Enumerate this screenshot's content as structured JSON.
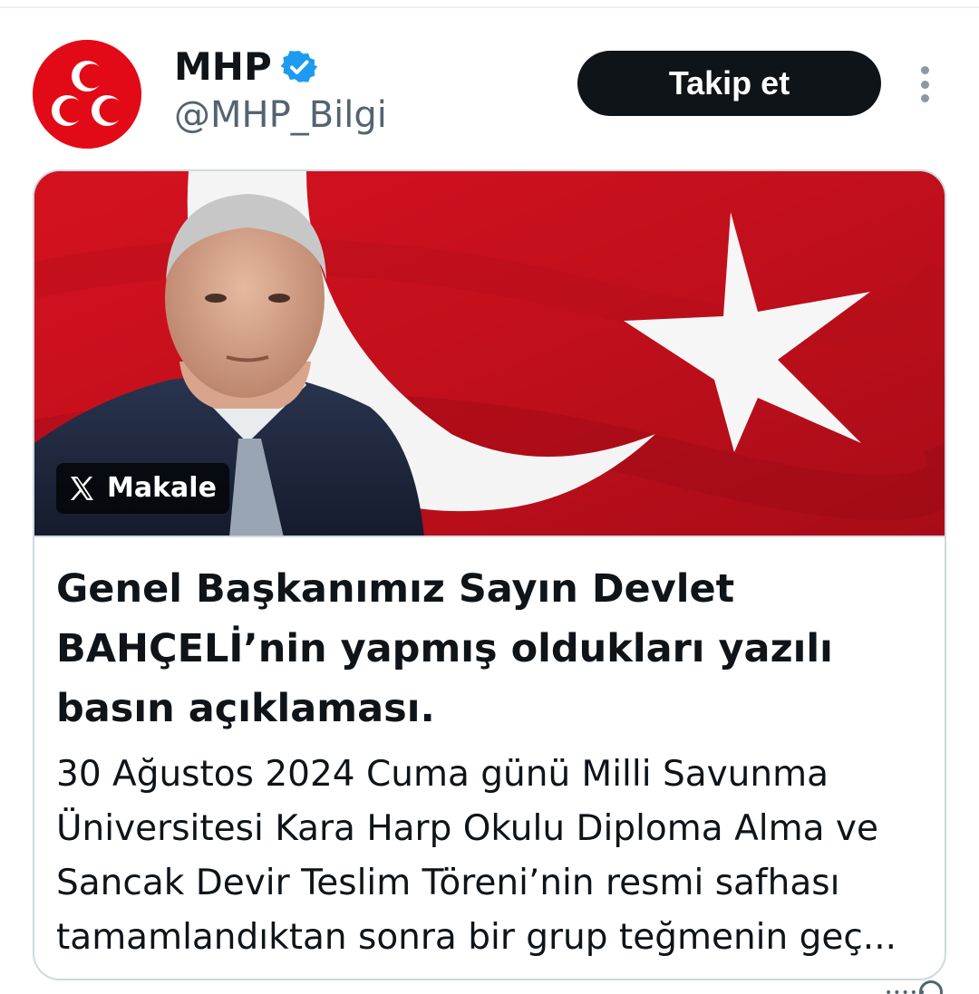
{
  "account": {
    "display_name": "MHP",
    "handle": "@MHP_Bilgi",
    "verified": true,
    "avatar": "mhp-three-crescents-logo"
  },
  "actions": {
    "follow_label": "Takip et",
    "more_icon": "more-vertical-icon"
  },
  "article": {
    "badge_label": "Makale",
    "badge_icon": "x-logo-icon",
    "title": "Genel Başkanımız Sayın Devlet BAHÇELİ’nin yapmış oldukları yazılı basın açıklaması.",
    "summary": "30 Ağustos 2024 Cuma günü Milli Savunma Üniversitesi Kara Harp Okulu Diploma Alma ve Sancak Devir Teslim Töreni’nin resmi safhası tamamlandıktan sonra bir grup teğmenin geç..."
  },
  "colors": {
    "text_primary": "#0f1419",
    "text_secondary": "#536471",
    "verified_blue": "#1d9bf0",
    "brand_red": "#e30a17",
    "card_border": "#cfd9de"
  }
}
